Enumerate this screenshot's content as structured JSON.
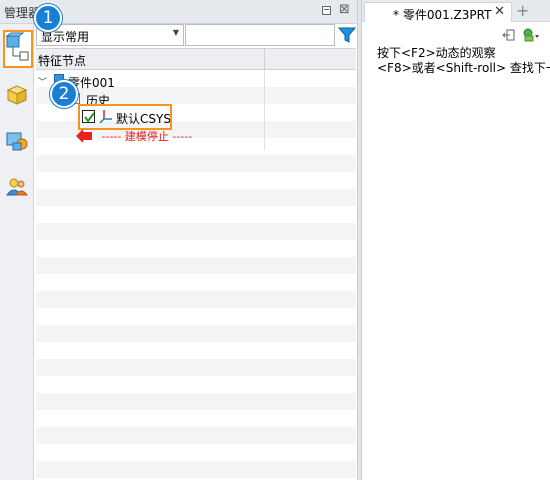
{
  "manager": {
    "title": "管理器",
    "restore_icon": "restore-icon",
    "close_icon": "close-icon"
  },
  "left_strip": {
    "items": [
      {
        "icon": "history-manager-icon"
      },
      {
        "icon": "view-manager-icon"
      },
      {
        "icon": "layer-manager-icon"
      },
      {
        "icon": "user-manager-icon"
      }
    ]
  },
  "toolbar": {
    "filter_value": "显示常用",
    "search_value": "",
    "filter_icon": "funnel-icon"
  },
  "tree": {
    "header": "特征节点",
    "nodes": {
      "part": "零件001",
      "history": "历史",
      "csys": "默认CSYS",
      "stop": "----- 建模停止 -----"
    }
  },
  "callouts": [
    "1",
    "2"
  ],
  "tab": {
    "label": "* 零件001.Z3PRT",
    "close": "✕",
    "add": "+"
  },
  "hints": {
    "line1": "按下<F2>动态的观察",
    "line2": "<F8>或者<Shift-roll> 查找下一"
  },
  "colors": {
    "highlight": "#f7931e",
    "callout": "#1a7fd4",
    "stop_text": "#e52222"
  }
}
